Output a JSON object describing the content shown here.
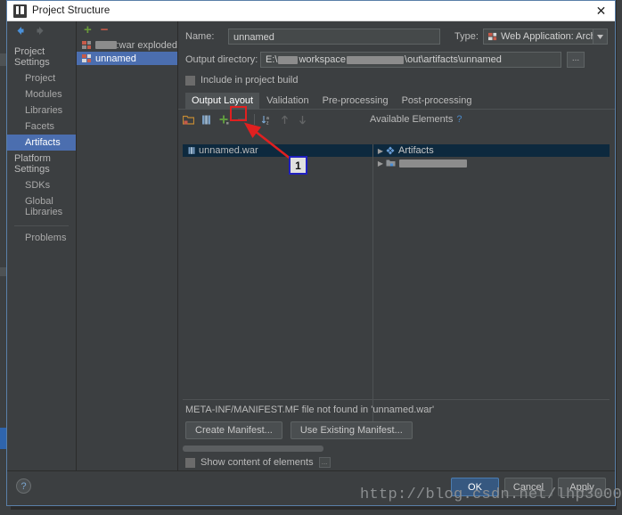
{
  "window": {
    "title": "Project Structure",
    "close_icon": "close-icon"
  },
  "nav": {
    "back_icon": "back-arrow-icon",
    "forward_icon": "forward-arrow-icon"
  },
  "sidebar": {
    "groups": [
      {
        "label": "Project Settings",
        "items": [
          {
            "label": "Project",
            "selected": false
          },
          {
            "label": "Modules",
            "selected": false
          },
          {
            "label": "Libraries",
            "selected": false
          },
          {
            "label": "Facets",
            "selected": false
          },
          {
            "label": "Artifacts",
            "selected": true
          }
        ]
      },
      {
        "label": "Platform Settings",
        "items": [
          {
            "label": "SDKs",
            "selected": false
          },
          {
            "label": "Global Libraries",
            "selected": false
          }
        ]
      }
    ],
    "problems_label": "Problems"
  },
  "artifact_list": {
    "add_label": "+",
    "remove_label": "−",
    "items": [
      {
        "label": ":war exploded",
        "redacted": true,
        "redact_width": 78,
        "selected": false
      },
      {
        "label": "unnamed",
        "redacted": false,
        "selected": true
      }
    ]
  },
  "detail": {
    "name_label": "Name:",
    "name_value": "unnamed",
    "type_label": "Type:",
    "type_value": "Web Application: Archive",
    "output_dir_label": "Output directory:",
    "output_dir_prefix": "E:\\",
    "output_dir_mid": "workspace",
    "output_dir_suffix": "\\out\\artifacts\\unnamed",
    "browse_label": "...",
    "include_in_build_label": "Include in project build",
    "include_in_build_checked": false,
    "tabs": [
      {
        "label": "Output Layout",
        "active": true
      },
      {
        "label": "Validation",
        "active": false
      },
      {
        "label": "Pre-processing",
        "active": false
      },
      {
        "label": "Post-processing",
        "active": false
      }
    ],
    "toolbar": [
      {
        "name": "add-directory-icon",
        "enabled": true
      },
      {
        "name": "add-archive-icon",
        "enabled": true
      },
      {
        "name": "add-copy-icon",
        "enabled": true
      },
      {
        "name": "remove-icon",
        "enabled": false
      },
      {
        "name": "sort-icon",
        "enabled": true
      },
      {
        "name": "move-up-icon",
        "enabled": false
      },
      {
        "name": "move-down-icon",
        "enabled": false
      }
    ],
    "available_elements_label": "Available Elements",
    "help_label": "?",
    "output_tree": [
      {
        "label": "unnamed.war",
        "icon": "archive-icon",
        "selected": true,
        "redacted_tail": true
      }
    ],
    "available_tree": [
      {
        "label": "Artifacts",
        "icon": "artifacts-icon",
        "toggle": "▶",
        "selected": true,
        "redacted": false
      },
      {
        "label": "",
        "icon": "module-icon",
        "toggle": "▶",
        "selected": false,
        "redacted": true,
        "redact_width": 76
      }
    ],
    "manifest_message": "META-INF/MANIFEST.MF file not found in 'unnamed.war'",
    "create_manifest_label": "Create Manifest...",
    "use_existing_manifest_label": "Use Existing Manifest...",
    "show_content_label": "Show content of elements",
    "show_content_checked": false,
    "show_content_ellipsis": "..."
  },
  "footer": {
    "help_label": "?",
    "buttons": [
      {
        "label": "OK",
        "primary": true
      },
      {
        "label": "Cancel",
        "primary": false
      },
      {
        "label": "Apply",
        "primary": false
      }
    ]
  },
  "annotation": {
    "badge_label": "1",
    "box_color": "#e02020",
    "badge_border_color": "#2020c0",
    "arrow_color": "#e02020"
  },
  "watermark": {
    "text": "http://blog.csdn.net/lhp3000"
  }
}
